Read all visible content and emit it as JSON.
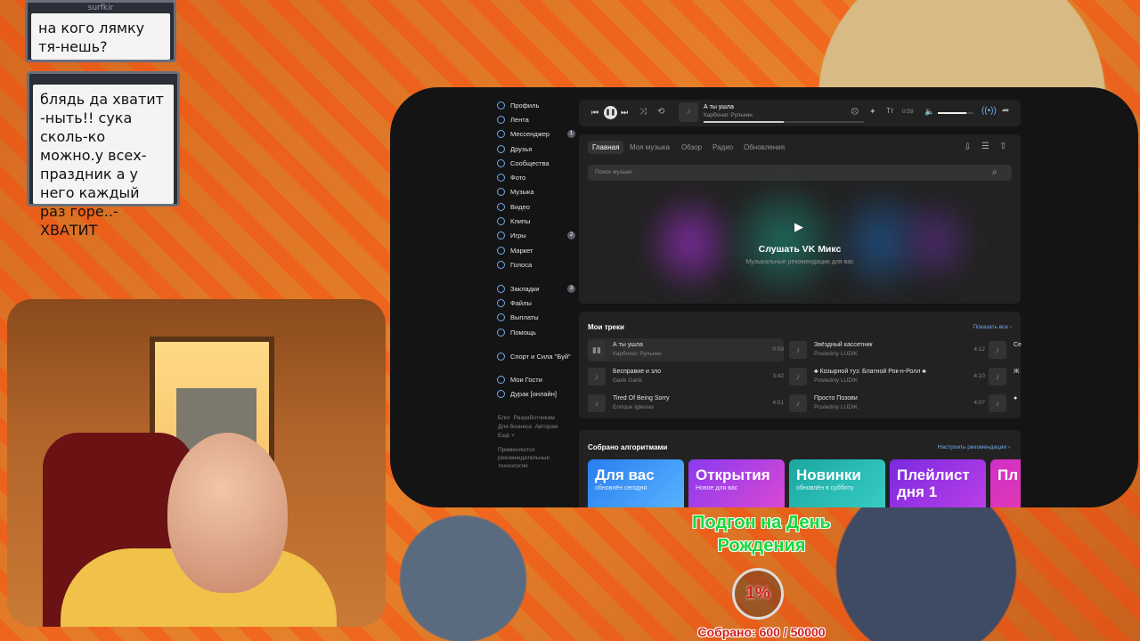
{
  "chat": [
    {
      "user": "surfkir",
      "text": "на кого лямку тя-нешь?"
    },
    {
      "user": "",
      "text": "блядь да хватит -ныть!! сука сколь-ко можно.у всех-праздник а у него каждый раз горе..-ХВАТИТ"
    }
  ],
  "sidebar": {
    "items": [
      {
        "label": "Профиль",
        "icon": "user-icon"
      },
      {
        "label": "Лента",
        "icon": "news-icon"
      },
      {
        "label": "Мессенджер",
        "icon": "message-icon",
        "badge": "1"
      },
      {
        "label": "Друзья",
        "icon": "friends-icon"
      },
      {
        "label": "Сообщества",
        "icon": "groups-icon"
      },
      {
        "label": "Фото",
        "icon": "photo-icon"
      },
      {
        "label": "Музыка",
        "icon": "music-icon"
      },
      {
        "label": "Видео",
        "icon": "video-icon"
      },
      {
        "label": "Клипы",
        "icon": "clips-icon"
      },
      {
        "label": "Игры",
        "icon": "games-icon",
        "badge": "2"
      },
      {
        "label": "Маркет",
        "icon": "market-icon"
      },
      {
        "label": "Голоса",
        "icon": "votes-icon"
      }
    ],
    "items2": [
      {
        "label": "Закладки",
        "icon": "bookmark-icon",
        "badge": "3"
      },
      {
        "label": "Файлы",
        "icon": "files-icon"
      },
      {
        "label": "Выплаты",
        "icon": "payments-icon"
      },
      {
        "label": "Помощь",
        "icon": "help-icon"
      }
    ],
    "items3": [
      {
        "label": "Спорт и Сила \"Буй\"",
        "icon": "app-icon"
      }
    ],
    "items4": [
      {
        "label": "Мои Гости",
        "icon": "guests-icon"
      },
      {
        "label": "Дурак [онлайн]",
        "icon": "cards-icon"
      }
    ],
    "footer": {
      "l1a": "Блог",
      "l1b": "Разработчикам",
      "l2a": "Для бизнеса",
      "l2b": "Авторам",
      "l3": "Ещё ˅",
      "note1": "Применяются",
      "note2": "рекомендательные",
      "note3": "технологии"
    }
  },
  "player": {
    "title": "А ты ушла",
    "artist": "Карбонат Рулькин",
    "time": "0:59",
    "progress": 0.5,
    "volume": 0.8
  },
  "music": {
    "tabs": [
      "Главная",
      "Моя музыка",
      "Обзор",
      "Радио",
      "Обновления"
    ],
    "search_placeholder": "Поиск музыки",
    "mix_title": "Слушать VK Микс",
    "mix_sub": "Музыкальные рекомендации для вас"
  },
  "my_tracks": {
    "heading": "Мои треки",
    "show_all": "Показать все ›",
    "tracks": [
      {
        "title": "А ты ушла",
        "artist": "Карбонат Рулькин",
        "dur": "0:59"
      },
      {
        "title": "Бесправие и зло",
        "artist": "Garik Garik",
        "dur": "3:42"
      },
      {
        "title": "Tired Of Being Sorry",
        "artist": "Enrique Iglesias",
        "dur": "4:01"
      },
      {
        "title": "Звёздный кассетник",
        "artist": "Posledniy LUDIK",
        "dur": "4:12"
      },
      {
        "title": "♣ Козырной туз: Блатной Рок-н-Ролл ♣",
        "artist": "Posledniy LUDIK",
        "dur": "4:10"
      },
      {
        "title": "Просто Позови",
        "artist": "Posledniy LUDIK",
        "dur": "4:07"
      },
      {
        "title": "Се",
        "artist": "",
        "dur": ""
      },
      {
        "title": "Ж",
        "artist": "",
        "dur": ""
      },
      {
        "title": "●",
        "artist": "",
        "dur": ""
      }
    ]
  },
  "algo": {
    "heading": "Собрано алгоритмами",
    "settings": "Настроить рекомендации ›",
    "cards": [
      {
        "title": "Для вас",
        "sub": "обновлён сегодня"
      },
      {
        "title": "Открытия",
        "sub": "Новое для вас"
      },
      {
        "title": "Новинки",
        "sub": "обновлён в субботу"
      },
      {
        "title": "Плейлист дня 1",
        "sub": ""
      },
      {
        "title": "Пл дн",
        "sub": ""
      }
    ]
  },
  "goal": {
    "title": "Подгон на День Рождения",
    "percent": "1%",
    "collected": "Собрано: 600 / 50000"
  }
}
